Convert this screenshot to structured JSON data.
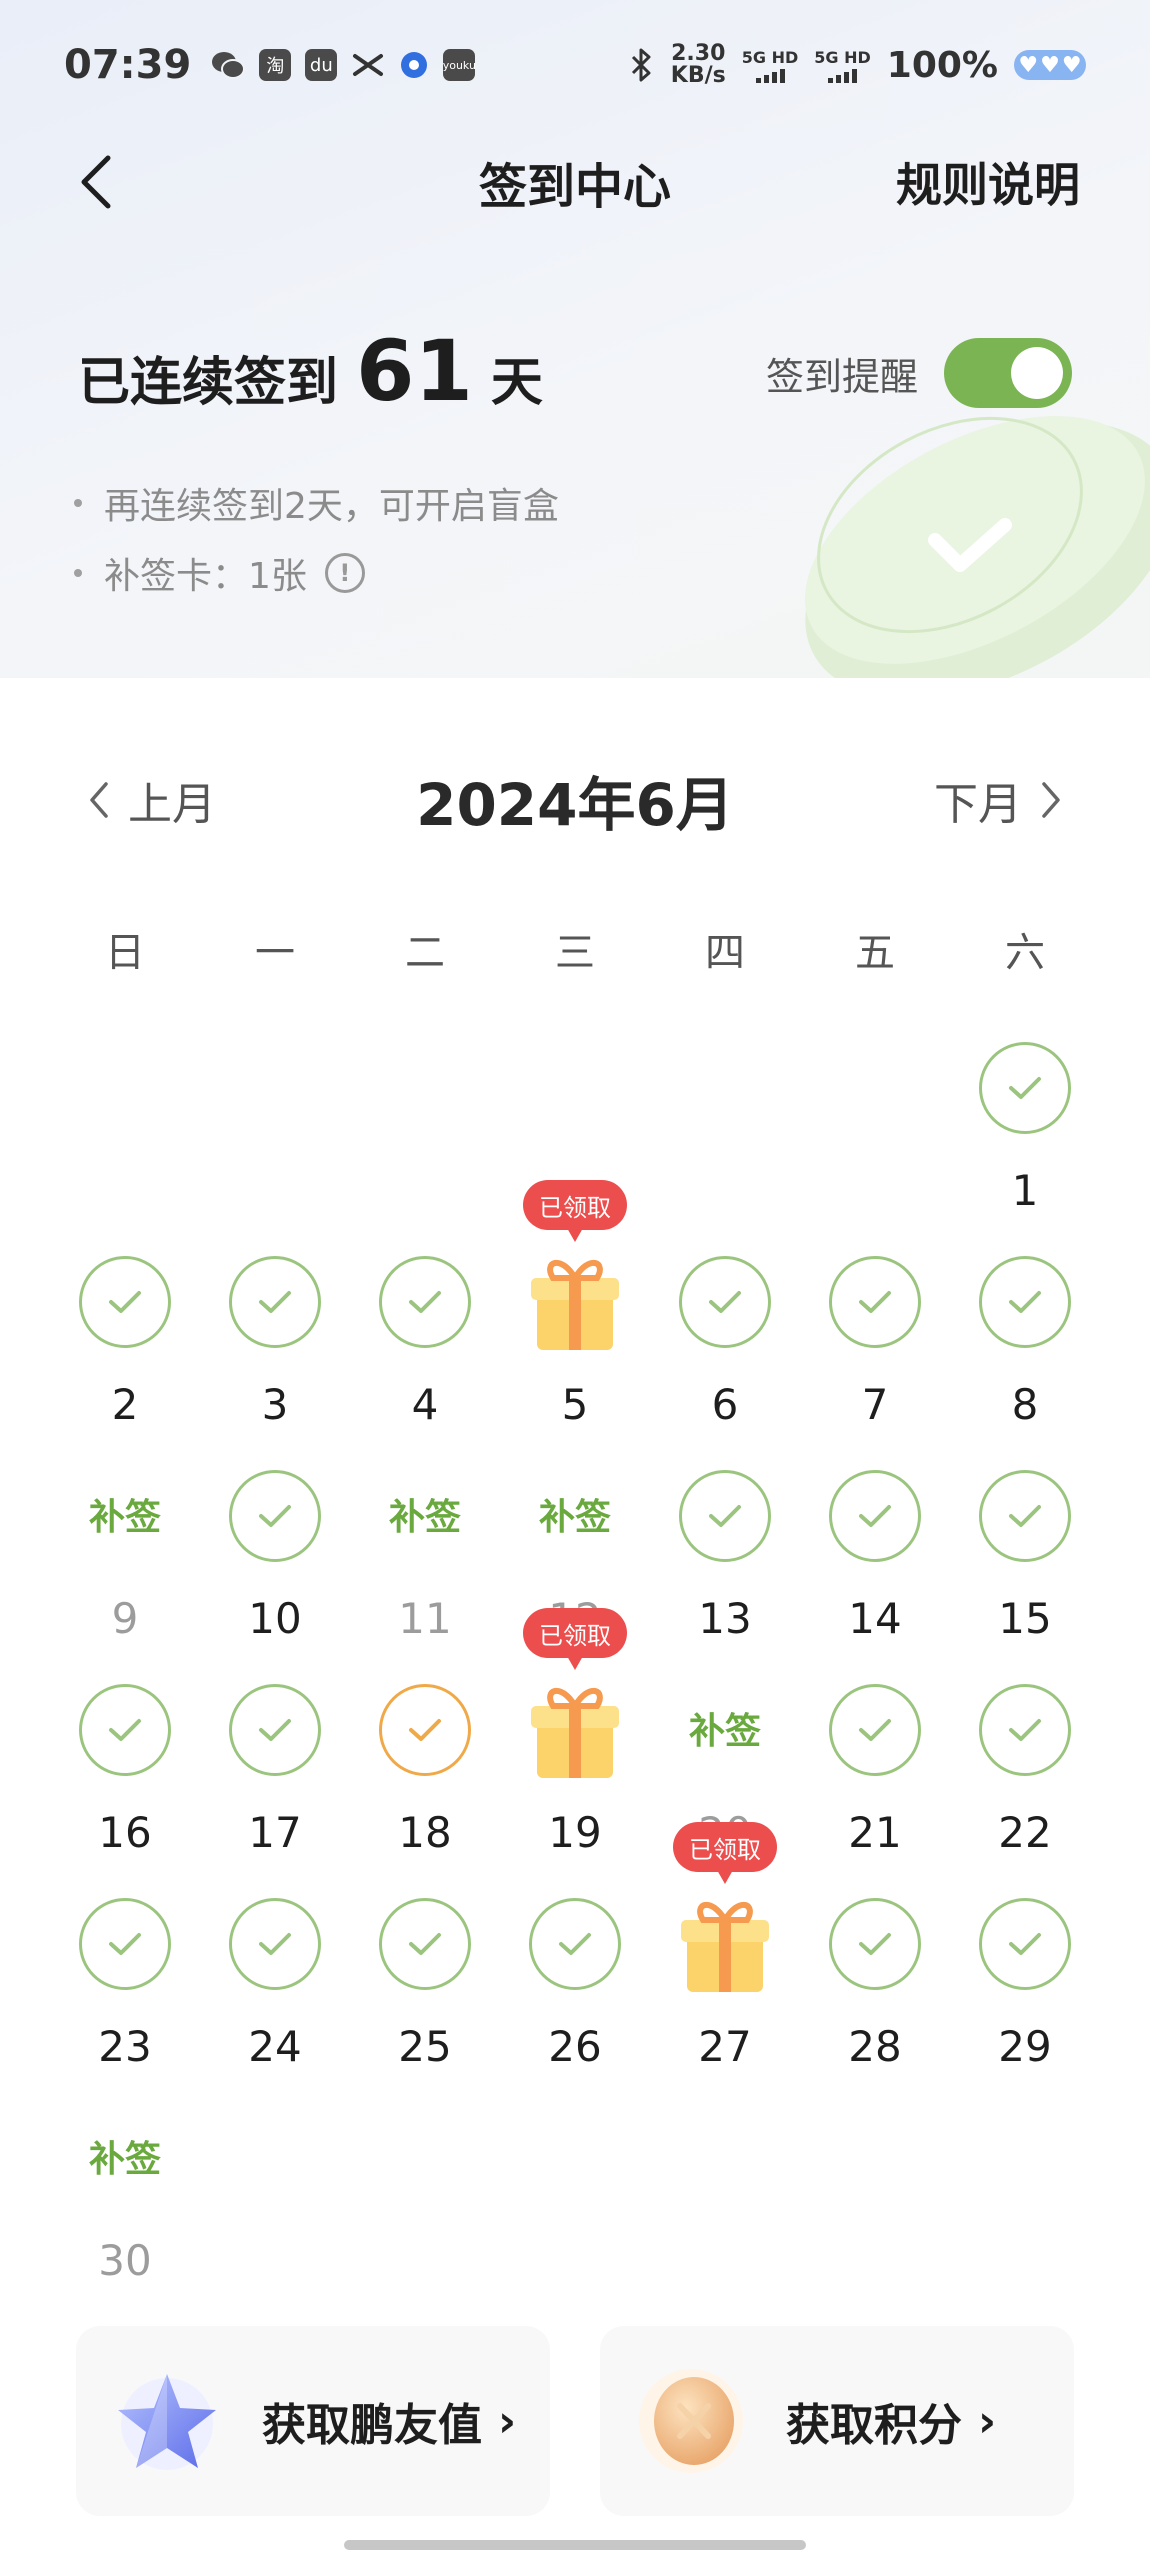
{
  "status_bar": {
    "time": "07:39",
    "net_speed_value": "2.30",
    "net_speed_unit": "KB/s",
    "signal1_label": "5G HD",
    "signal2_label": "5G HD",
    "battery_percent": "100%",
    "app_icons": [
      "wechat-icon",
      "taobao-icon",
      "app-icon",
      "scissors-icon",
      "dot-app-icon",
      "youku-icon"
    ]
  },
  "nav": {
    "title": "签到中心",
    "rules_label": "规则说明"
  },
  "streak": {
    "prefix": "已连续签到",
    "days": "61",
    "suffix": "天",
    "reminder_label": "签到提醒",
    "reminder_on": true
  },
  "info": {
    "line1": "再连续签到2天，可开启盲盒",
    "line2": "补签卡：1张"
  },
  "calendar": {
    "prev_label": "上月",
    "next_label": "下月",
    "month_title": "2024年6月",
    "weekdays": [
      "日",
      "一",
      "二",
      "三",
      "四",
      "五",
      "六"
    ],
    "leading_blanks": 6,
    "makeup_label": "补签",
    "claimed_label": "已领取",
    "days": [
      {
        "num": "1",
        "state": "checked"
      },
      {
        "num": "2",
        "state": "checked"
      },
      {
        "num": "3",
        "state": "checked"
      },
      {
        "num": "4",
        "state": "checked"
      },
      {
        "num": "5",
        "state": "gift"
      },
      {
        "num": "6",
        "state": "checked"
      },
      {
        "num": "7",
        "state": "checked"
      },
      {
        "num": "8",
        "state": "checked"
      },
      {
        "num": "9",
        "state": "makeup"
      },
      {
        "num": "10",
        "state": "checked"
      },
      {
        "num": "11",
        "state": "makeup"
      },
      {
        "num": "12",
        "state": "makeup"
      },
      {
        "num": "13",
        "state": "checked"
      },
      {
        "num": "14",
        "state": "checked"
      },
      {
        "num": "15",
        "state": "checked"
      },
      {
        "num": "16",
        "state": "checked"
      },
      {
        "num": "17",
        "state": "checked"
      },
      {
        "num": "18",
        "state": "today"
      },
      {
        "num": "19",
        "state": "gift"
      },
      {
        "num": "20",
        "state": "makeup"
      },
      {
        "num": "21",
        "state": "checked"
      },
      {
        "num": "22",
        "state": "checked"
      },
      {
        "num": "23",
        "state": "checked"
      },
      {
        "num": "24",
        "state": "checked"
      },
      {
        "num": "25",
        "state": "checked"
      },
      {
        "num": "26",
        "state": "checked"
      },
      {
        "num": "27",
        "state": "gift"
      },
      {
        "num": "28",
        "state": "checked"
      },
      {
        "num": "29",
        "state": "checked"
      },
      {
        "num": "30",
        "state": "makeup"
      }
    ]
  },
  "cards": [
    {
      "label": "获取鹏友值",
      "icon": "star-icon"
    },
    {
      "label": "获取积分",
      "icon": "coin-icon"
    }
  ],
  "colors": {
    "accent_green": "#7bb553",
    "check_border": "#9bc57f",
    "today_border": "#f0a948",
    "tag_red": "#ec4d4d"
  }
}
